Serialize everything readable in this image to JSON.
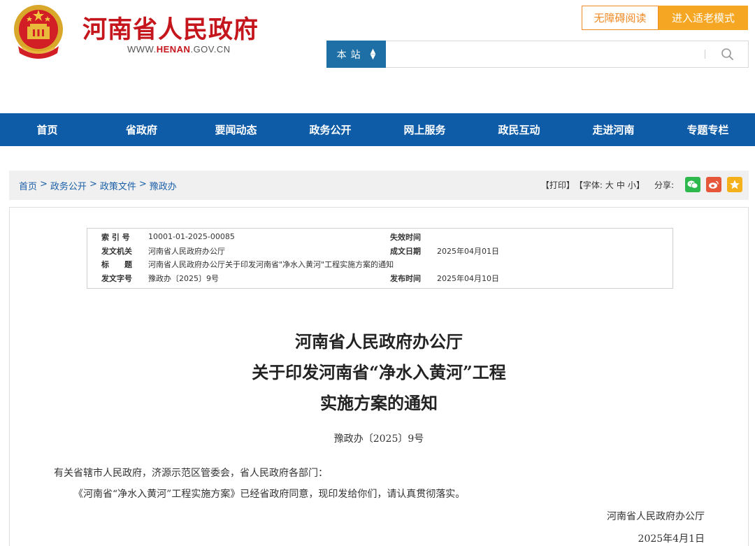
{
  "header": {
    "site_title": "河南省人民政府",
    "site_url_prefix": "WWW.",
    "site_url_highlight": "HENAN",
    "site_url_suffix": ".GOV.CN",
    "accessible_label": "无障碍阅读",
    "elder_mode_label": "进入适老模式"
  },
  "search": {
    "scope": "本站",
    "placeholder": "",
    "value": ""
  },
  "nav": {
    "items": [
      "首页",
      "省政府",
      "要闻动态",
      "政务公开",
      "网上服务",
      "政民互动",
      "走进河南",
      "专题专栏"
    ]
  },
  "breadcrumb": {
    "items": [
      "首页",
      "政务公开",
      "政策文件",
      "豫政办"
    ],
    "separator": ">"
  },
  "tools": {
    "print": "【打印】",
    "font_prefix": "【字体:",
    "font_large": "大",
    "font_medium": "中",
    "font_small": "小",
    "font_suffix": "】",
    "share_label": "分享:"
  },
  "meta": {
    "index_label": "索 引 号",
    "index_value": "10001-01-2025-00085",
    "expire_label": "失效时间",
    "expire_value": "",
    "issuer_label": "发文机关",
    "issuer_value": "河南省人民政府办公厅",
    "created_label": "成文日期",
    "created_value": "2025年04月01日",
    "title_label": "标　　题",
    "title_value": "河南省人民政府办公厅关于印发河南省\"净水入黄河\"工程实施方案的通知",
    "docno_label": "发文字号",
    "docno_value": "豫政办〔2025〕9号",
    "published_label": "发布时间",
    "published_value": "2025年04月10日"
  },
  "document": {
    "title_line1": "河南省人民政府办公厅",
    "title_line2": "关于印发河南省“净水入黄河”工程",
    "title_line3": "实施方案的通知",
    "doc_number": "豫政办〔2025〕9号",
    "salutation": "有关省辖市人民政府，济源示范区管委会，省人民政府各部门：",
    "body": "《河南省“净水入黄河”工程实施方案》已经省政府同意，现印发给你们，请认真贯彻落实。",
    "signer": "河南省人民政府办公厅",
    "date": "2025年4月1日"
  },
  "colors": {
    "brand_red": "#c4161c",
    "nav_blue": "#0e5ca8",
    "search_blue": "#1d6fa5",
    "accent_orange": "#f5a623"
  }
}
